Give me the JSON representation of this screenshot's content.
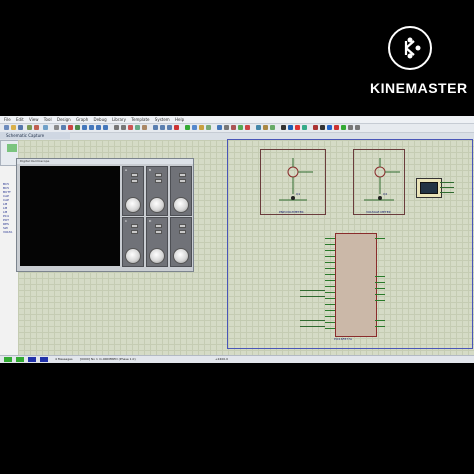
{
  "watermark": {
    "brand": "KINEMASTER",
    "logo_letter": "K"
  },
  "app": {
    "menu": [
      "File",
      "Edit",
      "View",
      "Tool",
      "Design",
      "Graph",
      "Debug",
      "Library",
      "Template",
      "System",
      "Help"
    ],
    "tab": "Schematic Capture",
    "oscilloscope_title": "Digital Oscilloscope",
    "channels": [
      "A",
      "B",
      "C",
      "D"
    ],
    "devices": [
      "BC5",
      "BC5",
      "BUTT",
      "CAP",
      "CAP",
      "LM",
      "LM",
      "LM",
      "PC4",
      "POT",
      "RES",
      "SW",
      "VOLTA"
    ],
    "status_text": "[0000] No 1 m.ORDERED (Phase 1.0)",
    "status_messages": "4 Messages",
    "status_coords": "+2400.0"
  },
  "schematic": {
    "block1_caption": "PNP/VOLTMETER",
    "block2_caption": "VOLTAGE METER",
    "q1": "Q1",
    "q2": "Q2",
    "mcu_label": "PIC16F877A"
  },
  "colors": {
    "accent": "#4a56b8",
    "grid": "#d5dbc6",
    "wire": "#2f6b2f",
    "part": "#8a2b2b"
  }
}
